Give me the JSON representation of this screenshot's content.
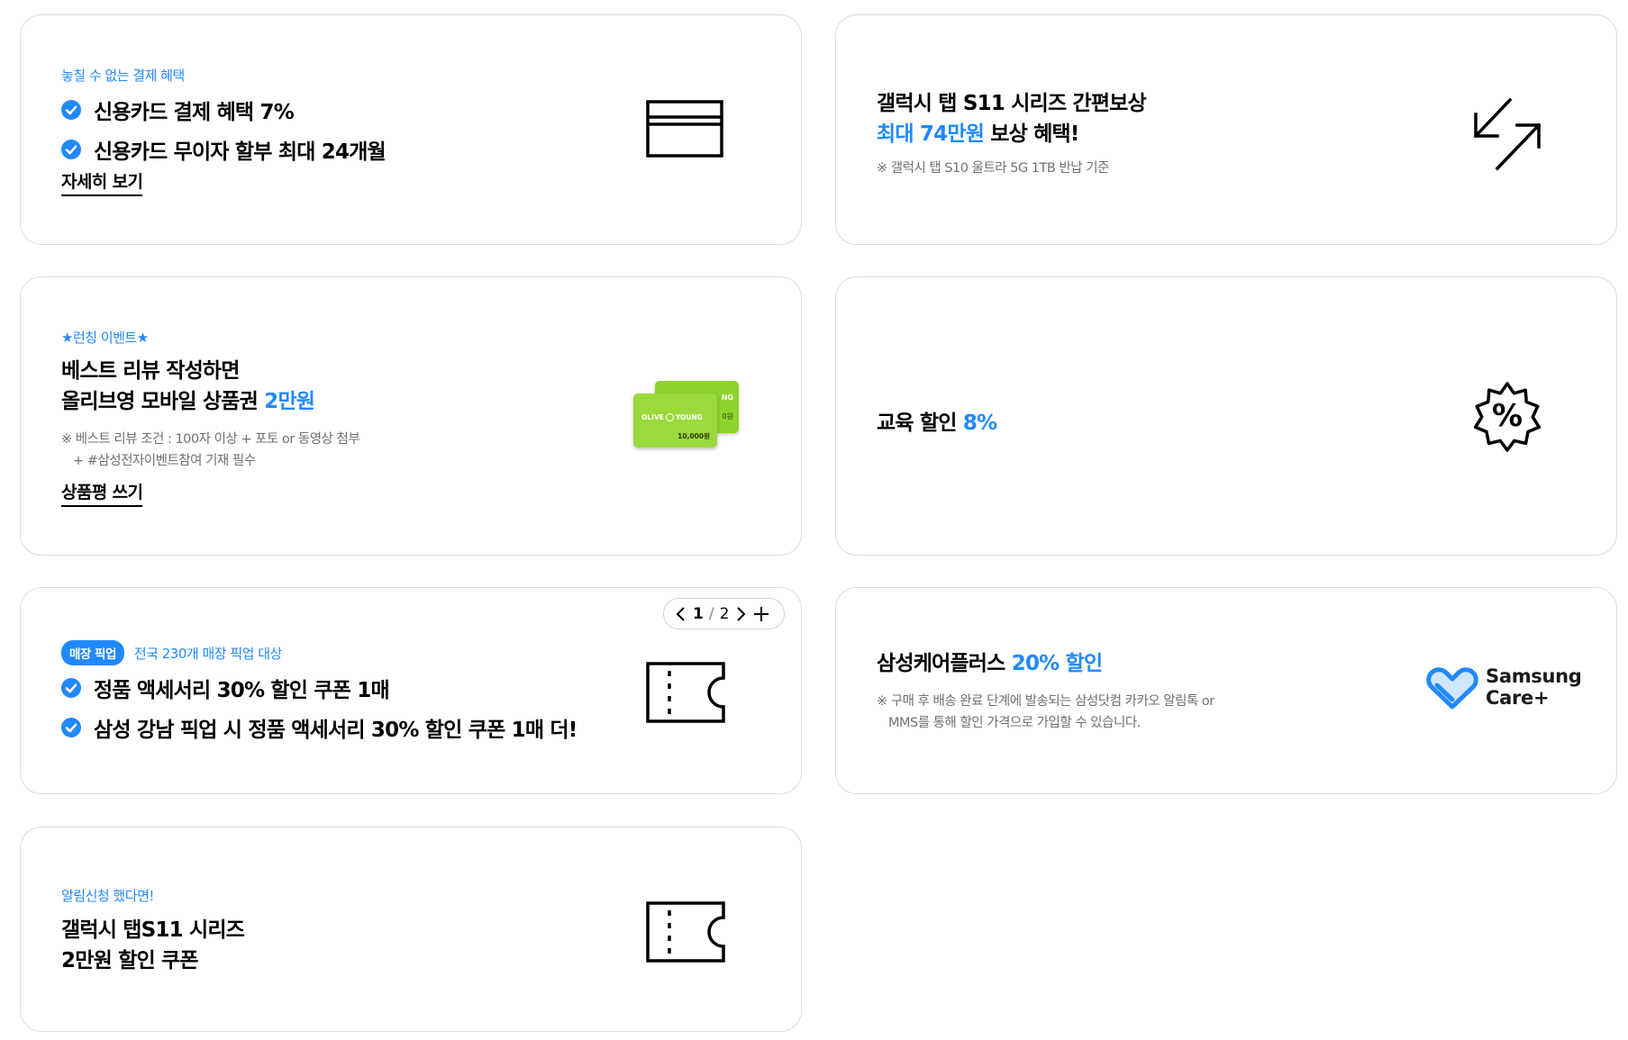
{
  "card_payment": {
    "eyebrow": "놓칠 수 없는 결제 혜택",
    "benefit_1": "신용카드 결제 혜택 7%",
    "benefit_2": "신용카드 무이자 할부 최대 24개월",
    "link": "자세히 보기",
    "icon": "credit-card-icon"
  },
  "trade_in": {
    "line_1": "갤럭시 탭 S11 시리즈 간편보상",
    "line_2_highlight": "최대 74만원",
    "line_2_rest": " 보상 혜택!",
    "note": "※ 갤럭시 탭 S10 울트라 5G 1TB 반납 기준",
    "icon": "exchange-arrows-icon"
  },
  "review_event": {
    "eyebrow": "★런칭 이벤트★",
    "line_1": "베스트 리뷰 작성하면",
    "line_2_prefix": "올리브영 모바일 상품권 ",
    "line_2_highlight": "2만원",
    "note_1": "※ 베스트 리뷰 조건 : 100자 이상 + 포토 or 동영상 첨부",
    "note_2": "+ #삼성전자이벤트참여 기재 필수",
    "link": "상품평 쓰기",
    "gift_card": {
      "brand_left": "OLIVE",
      "brand_right": "YOUNG",
      "amount": "10,000원",
      "back_tag": "NG",
      "back_amount": "0원"
    }
  },
  "education": {
    "prefix": "교육 할인 ",
    "highlight": "8%",
    "icon": "discount-badge-icon",
    "icon_text": "%"
  },
  "store_pickup": {
    "pill": "매장 픽업",
    "eyebrow": "전국 230개 매장 픽업 대상",
    "benefit_1": "정품 액세서리 30% 할인 쿠폰 1매",
    "benefit_2": "삼성 강남 픽업 시 정품 액세서리 30% 할인 쿠폰 1매 더!",
    "pager": {
      "current": "1",
      "separator": "/",
      "total": "2"
    },
    "icon": "coupon-icon"
  },
  "care_plus": {
    "prefix": "삼성케어플러스 ",
    "highlight": "20% 할인",
    "note_1": "※ 구매 후 배송 완료 단계에 발송되는 삼성닷컴 카카오 알림톡 or",
    "note_2": "MMS를 통해 할인 가격으로 가입할 수 있습니다.",
    "logo_line_1": "Samsung",
    "logo_line_2": "Care+",
    "icon": "heart-logo-icon"
  },
  "notify_coupon": {
    "eyebrow": "알림신청 했다면!",
    "line_1": "갤럭시 탭S11 시리즈",
    "line_2": "2만원 할인 쿠폰",
    "icon": "coupon-icon"
  },
  "colors": {
    "accent": "#2189ff",
    "border": "#dcdcdc",
    "note": "#707070",
    "gift_green": "#8cd42c"
  }
}
